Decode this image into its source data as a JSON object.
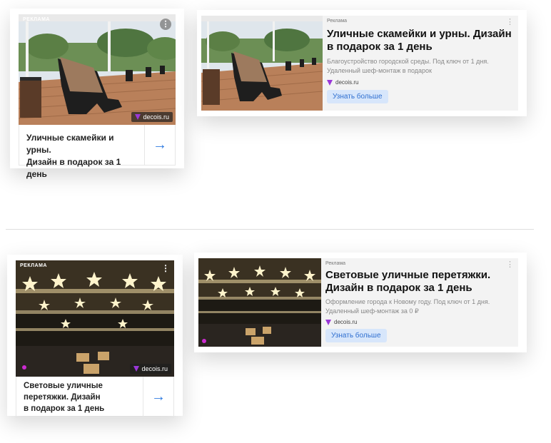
{
  "ad1": {
    "badge": "Реклама",
    "site": "decois.ru",
    "title_lines": [
      "Уличные скамейки и урны.",
      "Дизайн в подарок за 1 день"
    ],
    "arrow": "→"
  },
  "ad2": {
    "label": "Реклама",
    "headline_lines": [
      "Уличные скамейки и урны. Дизайн",
      "в подарок за 1 день"
    ],
    "desc_lines": [
      "Благоустройство городской среды. Под ключ от 1 дня.",
      "Удаленный шеф-монтаж в подарок"
    ],
    "domain": "decois.ru",
    "button": "Узнать больше"
  },
  "ad3": {
    "badge": "Реклама",
    "site": "decois.ru",
    "title_lines": [
      "Световые уличные",
      "перетяжки. Дизайн",
      "в подарок за 1 день"
    ],
    "arrow": "→"
  },
  "ad4": {
    "label": "Реклама",
    "headline_lines": [
      "Световые уличные перетяжки.",
      "Дизайн в подарок за 1 день"
    ],
    "desc_lines": [
      "Оформление города к Новому году. Под ключ от 1 дня.",
      "Удаленный шеф-монтаж за 0 ₽"
    ],
    "domain": "decois.ru",
    "button": "Узнать больше"
  },
  "icons": {
    "more": "kebab-menu",
    "logo": "brand-y-logo",
    "next": "arrow-right"
  },
  "colors": {
    "accent": "#2f7be0",
    "button_bg": "#d7e6fb",
    "logo": "#9a37d8",
    "ad_bg": "#f3f3f3"
  }
}
